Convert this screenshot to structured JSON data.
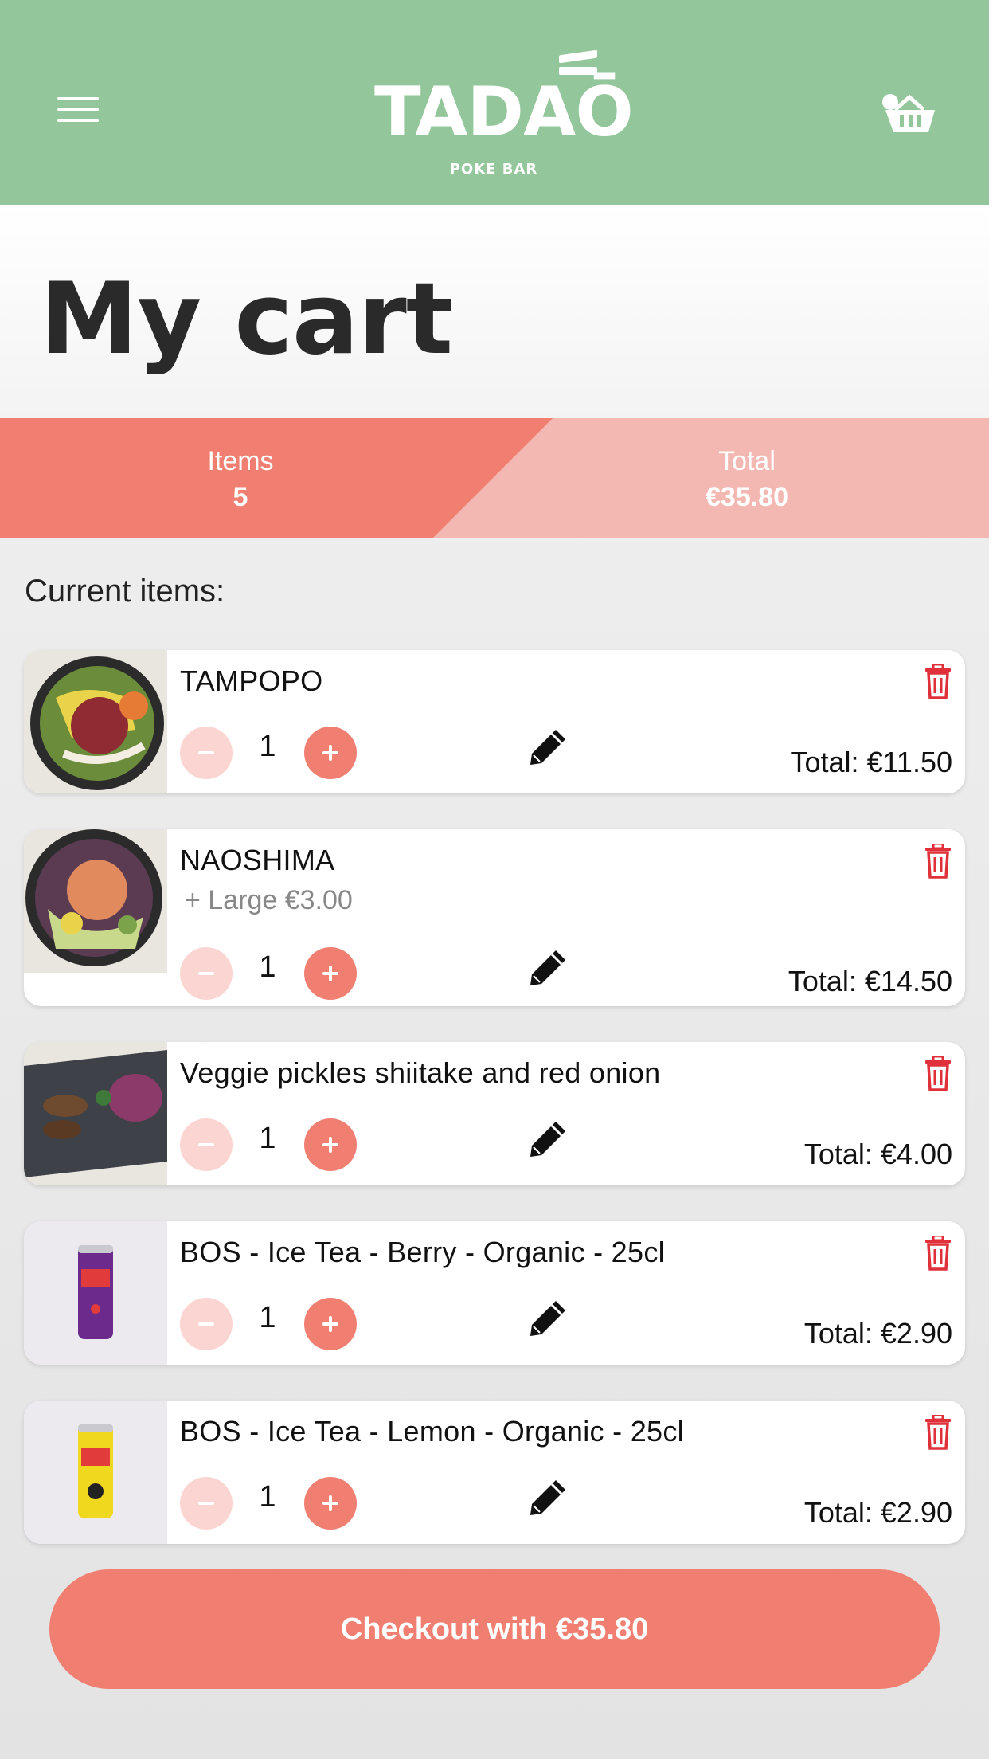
{
  "header": {
    "brand": "TADAŌ",
    "brand_sub": "POKE BAR",
    "menu_icon": "hamburger-icon",
    "cart_icon": "basket-icon",
    "color": "#93c69a"
  },
  "page": {
    "title": "My cart"
  },
  "summary": {
    "items_label": "Items",
    "items_value": "5",
    "total_label": "Total",
    "total_value": "€35.80",
    "colors": {
      "items_bg": "#f07f72",
      "total_bg": "#f4b8b2"
    }
  },
  "section_label": "Current items:",
  "items": [
    {
      "name": "TAMPOPO",
      "extra": "",
      "qty": "1",
      "total": "Total: €11.50"
    },
    {
      "name": "NAOSHIMA",
      "extra": "+ Large €3.00",
      "qty": "1",
      "total": "Total: €14.50"
    },
    {
      "name": "Veggie pickles shiitake and red onion",
      "extra": "",
      "qty": "1",
      "total": "Total: €4.00"
    },
    {
      "name": "BOS - Ice Tea - Berry - Organic - 25cl",
      "extra": "",
      "qty": "1",
      "total": "Total: €2.90"
    },
    {
      "name": "BOS - Ice Tea - Lemon - Organic - 25cl",
      "extra": "",
      "qty": "1",
      "total": "Total: €2.90"
    }
  ],
  "checkout": {
    "label": "Checkout with €35.80"
  },
  "colors": {
    "accent": "#f07f72",
    "accent_light": "#fbd5d2",
    "delete": "#e0303a"
  }
}
